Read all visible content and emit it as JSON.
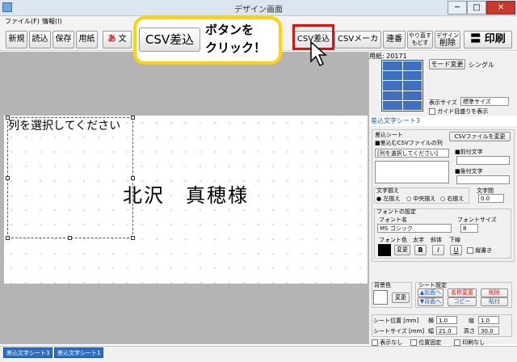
{
  "window": {
    "title": "デザイン画面",
    "minimize": "─",
    "maximize": "□",
    "close": "✕"
  },
  "menu": [
    "ファイル(F)",
    "情報(I)"
  ],
  "toolbar": {
    "shinki": "新規",
    "yomikomi": "読込",
    "hozon": "保存",
    "youshi": "用紙",
    "moji": "文",
    "csv_sashikomi": "CSV差込",
    "csv_maker": "CSVメーカー",
    "renban": "連番",
    "yarinaoshi": "やり直す",
    "modosu": "もどす",
    "design": "デザイン",
    "sakujo": "削除",
    "insatsu": "印刷"
  },
  "callout": {
    "button_label": "CSV差込",
    "line1": "ボタンを",
    "line2": "クリック！"
  },
  "canvas": {
    "column_placeholder": "列を選択してください",
    "name_text": "北沢　真穂様"
  },
  "paper_panel": {
    "paper_label": "用紙: 20171",
    "mode_button": "モード変更",
    "mode_value": "シングル",
    "display_size_label": "表示サイズ",
    "display_size_value": "標準サイズ",
    "guide_label": "ガイド目盛りを表示"
  },
  "insert_panel": {
    "header": "差込文字シート3",
    "group_label": "差込シート",
    "csv_column_label": "■差込むCSVファイルの列",
    "csv_change_button": "CSVファイルを変更",
    "column_select": "[列を選択してください]",
    "prefix_label": "■前付文字",
    "suffix_label": "■後付文字",
    "align_label": "文字揃え",
    "align_left": "左揃え",
    "align_center": "中央揃え",
    "align_right": "右揃え",
    "spacing_label": "文字間",
    "spacing_value": "0.0",
    "font_group": "フォントの設定",
    "font_name_label": "フォント名",
    "font_name_value": "MS ゴシック",
    "font_size_label": "フォントサイズ",
    "font_size_value": "8",
    "font_color_label": "フォント色",
    "bold_label": "太字",
    "italic_label": "斜体",
    "underline_label": "下線",
    "change_button": "変更",
    "bold_btn": "B",
    "italic_btn": "I",
    "underline_btn": "U",
    "vertical_label": "縦書き"
  },
  "bg_panel": {
    "bg_label": "背景色",
    "change_button": "変更",
    "sheet_settings": "シート設定",
    "front": "▲前面へ",
    "back": "▼背面へ",
    "name_change": "名称変更",
    "copy": "コピー",
    "delete": "削除",
    "paste": "貼付"
  },
  "position_panel": {
    "sheet_pos_label": "シート位置 [mm]",
    "x_label": "横",
    "x_value": "1.0",
    "y_label": "縦",
    "y_value": "1.0",
    "sheet_size_label": "シートサイズ [mm]",
    "w_label": "幅",
    "w_value": "21.0",
    "h_label": "高さ",
    "h_value": "30.0",
    "hide_label": "表示なし",
    "fix_label": "位置固定",
    "noprint_label": "印刷なし"
  },
  "tabs": [
    "差込文字シート3",
    "差込文字シート1"
  ],
  "colors": {
    "accent": "#ffd400",
    "red": "#e01010",
    "label_bg": "#1a5fb4"
  }
}
